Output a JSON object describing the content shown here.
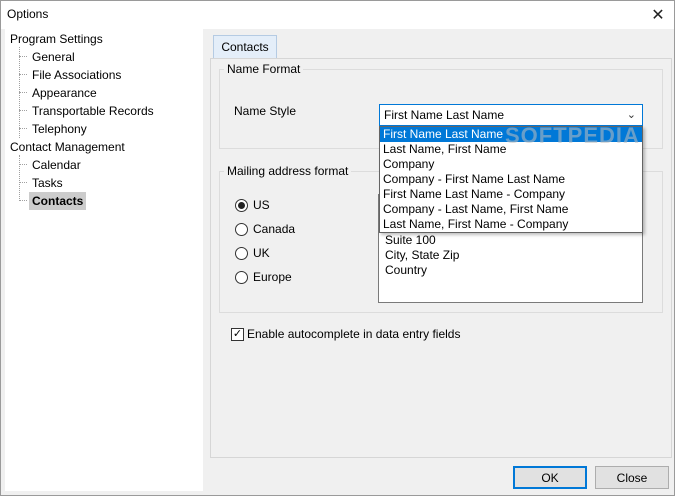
{
  "window": {
    "title": "Options"
  },
  "tree": {
    "parents": [
      {
        "label": "Program Settings",
        "children": [
          "General",
          "File Associations",
          "Appearance",
          "Transportable Records",
          "Telephony"
        ]
      },
      {
        "label": "Contact Management",
        "children": [
          "Calendar",
          "Tasks",
          "Contacts"
        ]
      }
    ],
    "selected": "Contacts"
  },
  "tab": {
    "label": "Contacts"
  },
  "name_format": {
    "group_title": "Name Format",
    "label": "Name Style",
    "selected": "First Name Last Name",
    "options": [
      "First Name Last Name",
      "Last Name, First Name",
      "Company",
      "Company - First Name Last Name",
      "First Name Last Name - Company",
      "Company - Last Name, First Name",
      "Last Name, First Name - Company"
    ]
  },
  "mailing": {
    "group_title": "Mailing address format",
    "options": [
      "US",
      "Canada",
      "UK",
      "Europe"
    ],
    "selected": "US",
    "preview_lines": [
      "Suite 100",
      "City, State Zip",
      "Country"
    ]
  },
  "autocomplete": {
    "label": "Enable autocomplete in data entry fields",
    "checked": true
  },
  "buttons": {
    "ok": "OK",
    "close": "Close"
  },
  "watermark": "SOFTPEDIA",
  "colors": {
    "accent": "#0078d7",
    "selection": "#cccccc"
  }
}
